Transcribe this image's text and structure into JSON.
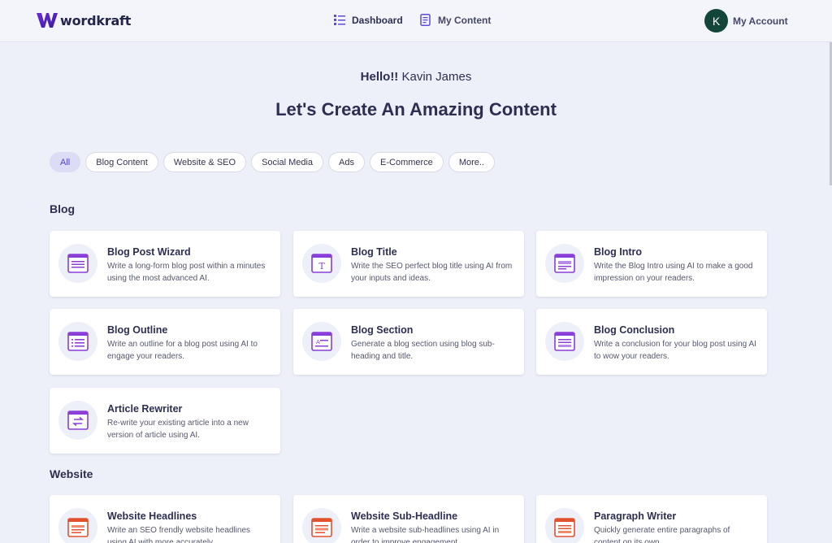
{
  "header": {
    "logo_text": "wordkraft",
    "nav": [
      {
        "label": "Dashboard",
        "icon": "dashboard-list-icon"
      },
      {
        "label": "My Content",
        "icon": "document-icon"
      }
    ],
    "account": {
      "initial": "K",
      "label": "My Account"
    }
  },
  "greeting": {
    "prefix": "Hello!!",
    "name": "Kavin James"
  },
  "headline": "Let's Create An Amazing Content",
  "filters": [
    {
      "label": "All",
      "active": true
    },
    {
      "label": "Blog Content",
      "active": false
    },
    {
      "label": "Website & SEO",
      "active": false
    },
    {
      "label": "Social Media",
      "active": false
    },
    {
      "label": "Ads",
      "active": false
    },
    {
      "label": "E-Commerce",
      "active": false
    },
    {
      "label": "More..",
      "active": false
    }
  ],
  "sections": [
    {
      "title": "Blog",
      "cards": [
        {
          "title": "Blog Post Wizard",
          "desc": "Write a long-form blog post within a minutes using the most advanced AI.",
          "icon": "blog-wizard-icon"
        },
        {
          "title": "Blog Title",
          "desc": "Write the SEO perfect blog title using AI from your inputs and ideas.",
          "icon": "blog-title-icon"
        },
        {
          "title": "Blog Intro",
          "desc": "Write the Blog Intro using AI to make a good impression on your readers.",
          "icon": "blog-intro-icon"
        },
        {
          "title": "Blog Outline",
          "desc": "Write an outline for a blog post using AI to engage your readers.",
          "icon": "blog-outline-icon"
        },
        {
          "title": "Blog Section",
          "desc": "Generate a blog section using blog sub-heading and title.",
          "icon": "blog-section-icon"
        },
        {
          "title": "Blog Conclusion",
          "desc": "Write a conclusion for your blog post using AI to wow your readers.",
          "icon": "blog-conclusion-icon"
        },
        {
          "title": "Article Rewriter",
          "desc": "Re-write your existing article into a new version of article using AI.",
          "icon": "article-rewriter-icon"
        }
      ]
    },
    {
      "title": "Website",
      "cards": [
        {
          "title": "Website Headlines",
          "desc": "Write an SEO frendly website headlines using AI with more accurately.",
          "icon": "website-headlines-icon"
        },
        {
          "title": "Website Sub-Headline",
          "desc": "Write a website sub-headlines using AI in order to improve engagement.",
          "icon": "website-subheadline-icon"
        },
        {
          "title": "Paragraph Writer",
          "desc": "Quickly generate entire paragraphs of content on its own.",
          "icon": "paragraph-writer-icon"
        }
      ]
    }
  ],
  "colors": {
    "background": "#eef0f9",
    "accent_purple": "#8b3fd9",
    "accent_orange": "#e2522f",
    "avatar": "#13463a",
    "active_chip": "#dcdcf7"
  }
}
